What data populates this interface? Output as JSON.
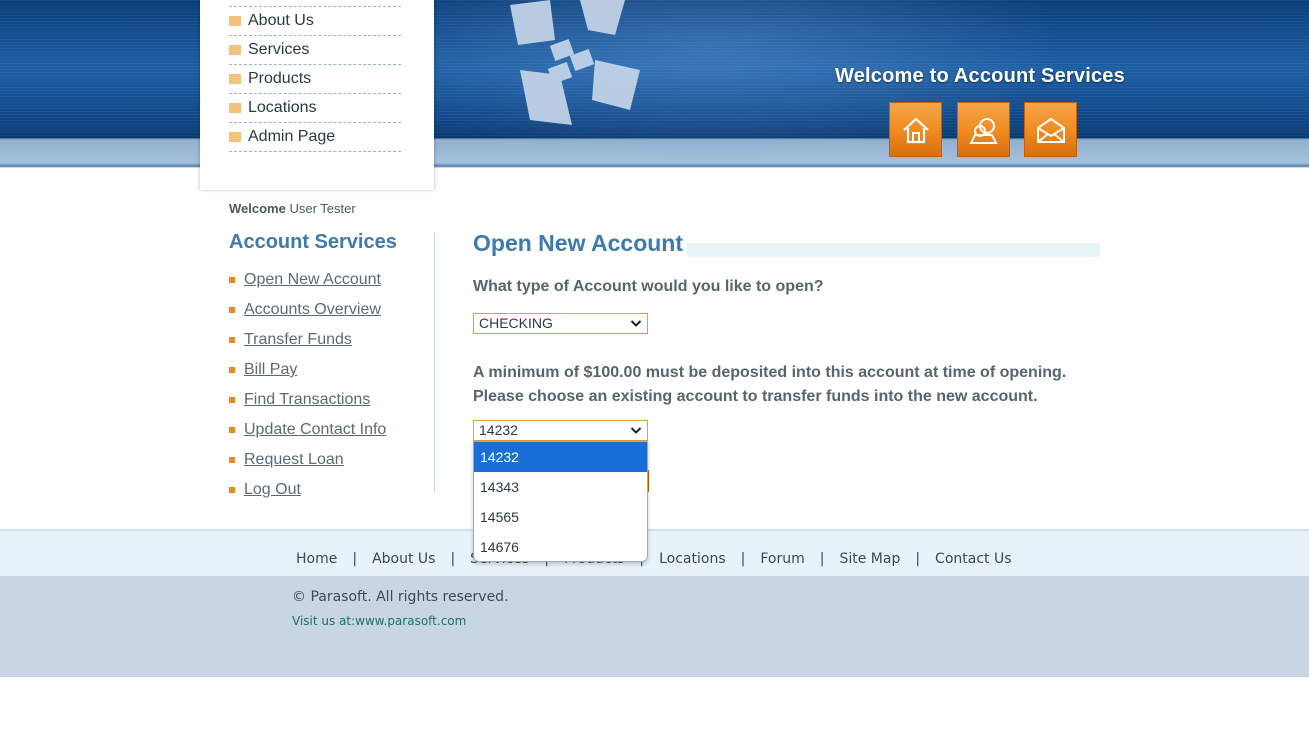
{
  "header": {
    "banner": "Welcome to Account Services",
    "icons": [
      "home-icon",
      "contact-icon",
      "mail-icon"
    ]
  },
  "top_menu": {
    "items": [
      {
        "label": "About Us"
      },
      {
        "label": "Services"
      },
      {
        "label": "Products"
      },
      {
        "label": "Locations"
      },
      {
        "label": "Admin Page"
      }
    ]
  },
  "welcome": {
    "prefix": "Welcome",
    "user": "User Tester"
  },
  "sidebar": {
    "title": "Account Services",
    "items": [
      {
        "label": "Open New Account"
      },
      {
        "label": "Accounts Overview"
      },
      {
        "label": "Transfer Funds"
      },
      {
        "label": "Bill Pay"
      },
      {
        "label": "Find Transactions"
      },
      {
        "label": "Update Contact Info"
      },
      {
        "label": "Request Loan"
      },
      {
        "label": "Log Out"
      }
    ]
  },
  "main": {
    "title": "Open New Account",
    "question": "What type of Account would you like to open?",
    "account_type": {
      "selected": "CHECKING"
    },
    "info_line1": "A minimum of $100.00 must be deposited into this account at time of opening.",
    "info_line2": "Please choose an existing account to transfer funds into the new account.",
    "from_account": {
      "selected": "14232",
      "options": [
        "14232",
        "14343",
        "14565",
        "14676"
      ]
    }
  },
  "footer": {
    "links": [
      "Home",
      "About Us",
      "Services",
      "Products",
      "Locations",
      "Forum",
      "Site Map",
      "Contact Us"
    ],
    "copyright": "© Parasoft. All rights reserved.",
    "visit": "Visit us at:www.parasoft.com"
  },
  "colors": {
    "accent_blue": "#3d7ab0",
    "orange": "#ef8a1e",
    "selected_option": "#1a6ed8"
  }
}
